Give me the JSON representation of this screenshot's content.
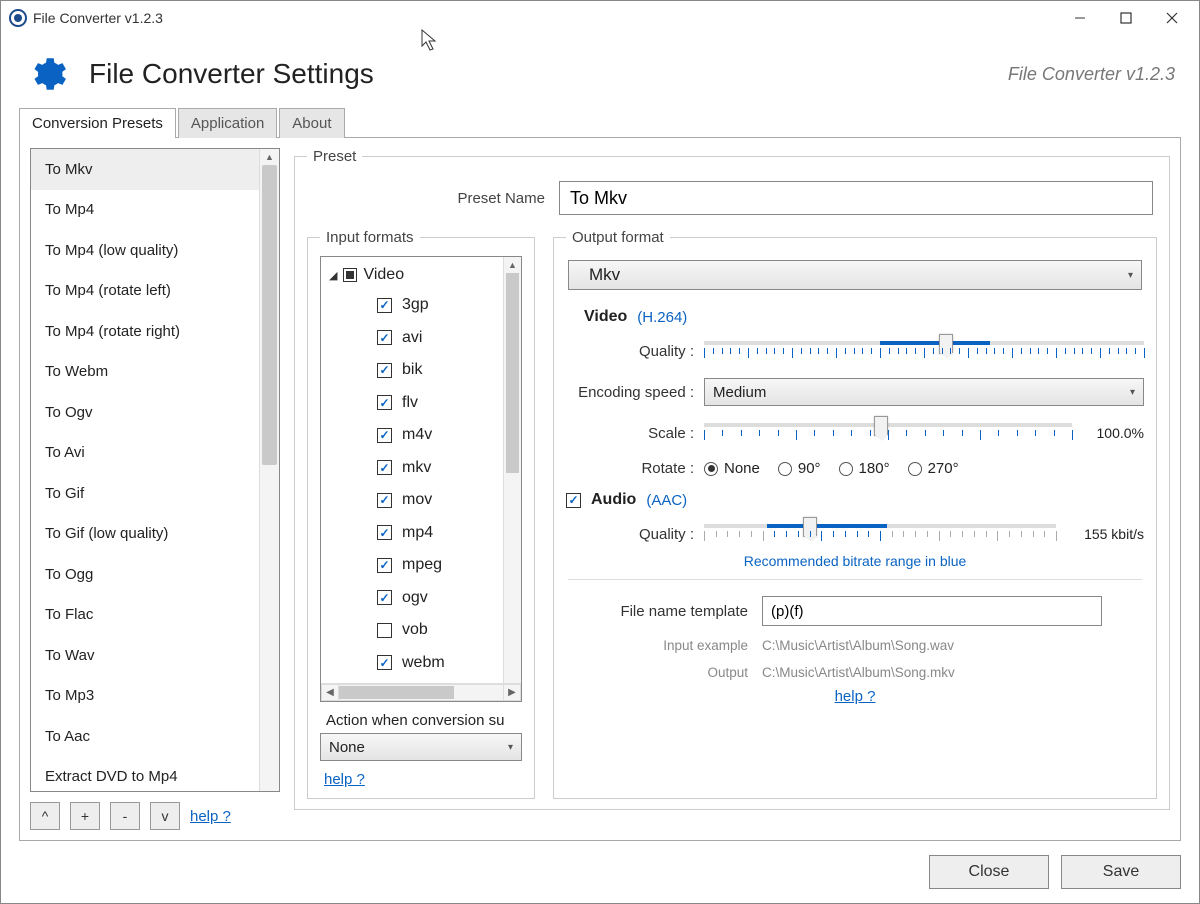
{
  "window_title": "File Converter v1.2.3",
  "header": {
    "title": "File Converter Settings",
    "version": "File Converter v1.2.3"
  },
  "tabs": {
    "conversion_presets": "Conversion Presets",
    "application": "Application",
    "about": "About"
  },
  "presets": {
    "items": [
      "To Mkv",
      "To Mp4",
      "To Mp4 (low quality)",
      "To Mp4 (rotate left)",
      "To Mp4 (rotate right)",
      "To Webm",
      "To Ogv",
      "To Avi",
      "To Gif",
      "To Gif (low quality)",
      "To Ogg",
      "To Flac",
      "To Wav",
      "To Mp3",
      "To Aac",
      "Extract DVD to Mp4"
    ],
    "selected_index": 0,
    "buttons": {
      "up": "^",
      "add": "+",
      "remove": "-",
      "down": "v"
    },
    "help": "help ?"
  },
  "preset_panel": {
    "legend": "Preset",
    "name_label": "Preset Name",
    "name_value": "To Mkv"
  },
  "input_formats": {
    "legend": "Input formats",
    "group_label": "Video",
    "items": [
      {
        "label": "3gp",
        "checked": true
      },
      {
        "label": "avi",
        "checked": true
      },
      {
        "label": "bik",
        "checked": true
      },
      {
        "label": "flv",
        "checked": true
      },
      {
        "label": "m4v",
        "checked": true
      },
      {
        "label": "mkv",
        "checked": true
      },
      {
        "label": "mov",
        "checked": true
      },
      {
        "label": "mp4",
        "checked": true
      },
      {
        "label": "mpeg",
        "checked": true
      },
      {
        "label": "ogv",
        "checked": true
      },
      {
        "label": "vob",
        "checked": false
      },
      {
        "label": "webm",
        "checked": true
      }
    ],
    "action_label": "Action when conversion su",
    "action_value": "None",
    "help": "help ?"
  },
  "output_format": {
    "legend": "Output format",
    "format_value": "Mkv",
    "video": {
      "heading": "Video",
      "codec": "(H.264)",
      "quality_label": "Quality :",
      "encoding_label": "Encoding speed :",
      "encoding_value": "Medium",
      "scale_label": "Scale :",
      "scale_value": "100.0%",
      "rotate_label": "Rotate :",
      "rotate_options": {
        "none": "None",
        "d90": "90°",
        "d180": "180°",
        "d270": "270°"
      },
      "rotate_selected": "none"
    },
    "audio": {
      "heading": "Audio",
      "codec": "(AAC)",
      "enabled": true,
      "quality_label": "Quality :",
      "quality_value": "155 kbit/s",
      "note": "Recommended bitrate range in blue"
    },
    "template": {
      "label": "File name template",
      "value": "(p)(f)",
      "input_example_label": "Input example",
      "input_example": "C:\\Music\\Artist\\Album\\Song.wav",
      "output_label": "Output",
      "output": "C:\\Music\\Artist\\Album\\Song.mkv",
      "help": "help ?"
    }
  },
  "footer": {
    "close": "Close",
    "save": "Save"
  }
}
